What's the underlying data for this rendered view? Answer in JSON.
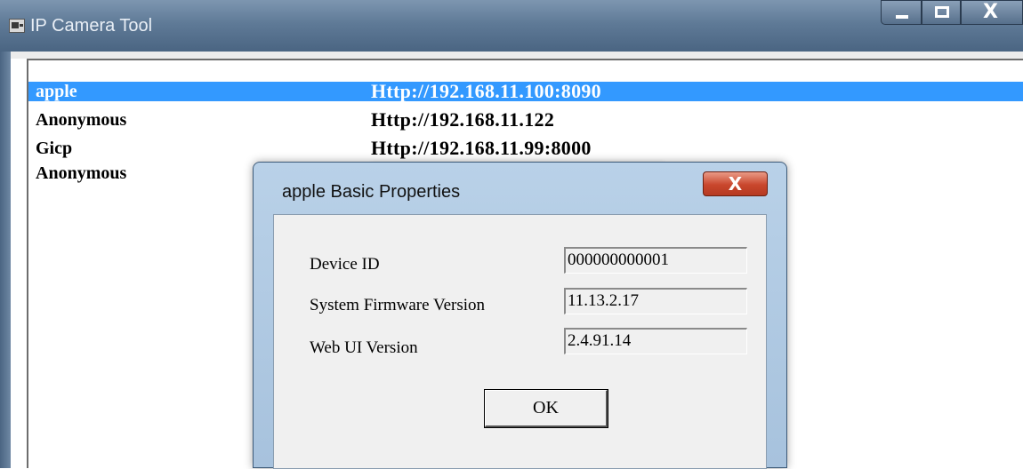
{
  "window": {
    "title": "IP Camera Tool",
    "controls": {
      "minimize": "minimize-icon",
      "maximize": "maximize-icon",
      "close": "X"
    }
  },
  "devices": [
    {
      "name": "apple",
      "url": "Http://192.168.11.100:8090",
      "selected": true
    },
    {
      "name": "Anonymous",
      "url": "Http://192.168.11.122",
      "selected": false
    },
    {
      "name": "Gicp",
      "url": "Http://192.168.11.99:8000",
      "selected": false
    },
    {
      "name": "Anonymous",
      "url": "",
      "selected": false
    }
  ],
  "dialog": {
    "title": "apple Basic Properties",
    "close_label": "X",
    "properties": [
      {
        "label": "Device ID",
        "value": "000000000001"
      },
      {
        "label": "System Firmware Version",
        "value": "11.13.2.17"
      },
      {
        "label": "Web UI Version",
        "value": "2.4.91.14"
      }
    ],
    "ok_label": "OK"
  },
  "colors": {
    "selection": "#3399ff",
    "titlebar": "#5f7a97",
    "dialog_close": "#c9462c"
  }
}
